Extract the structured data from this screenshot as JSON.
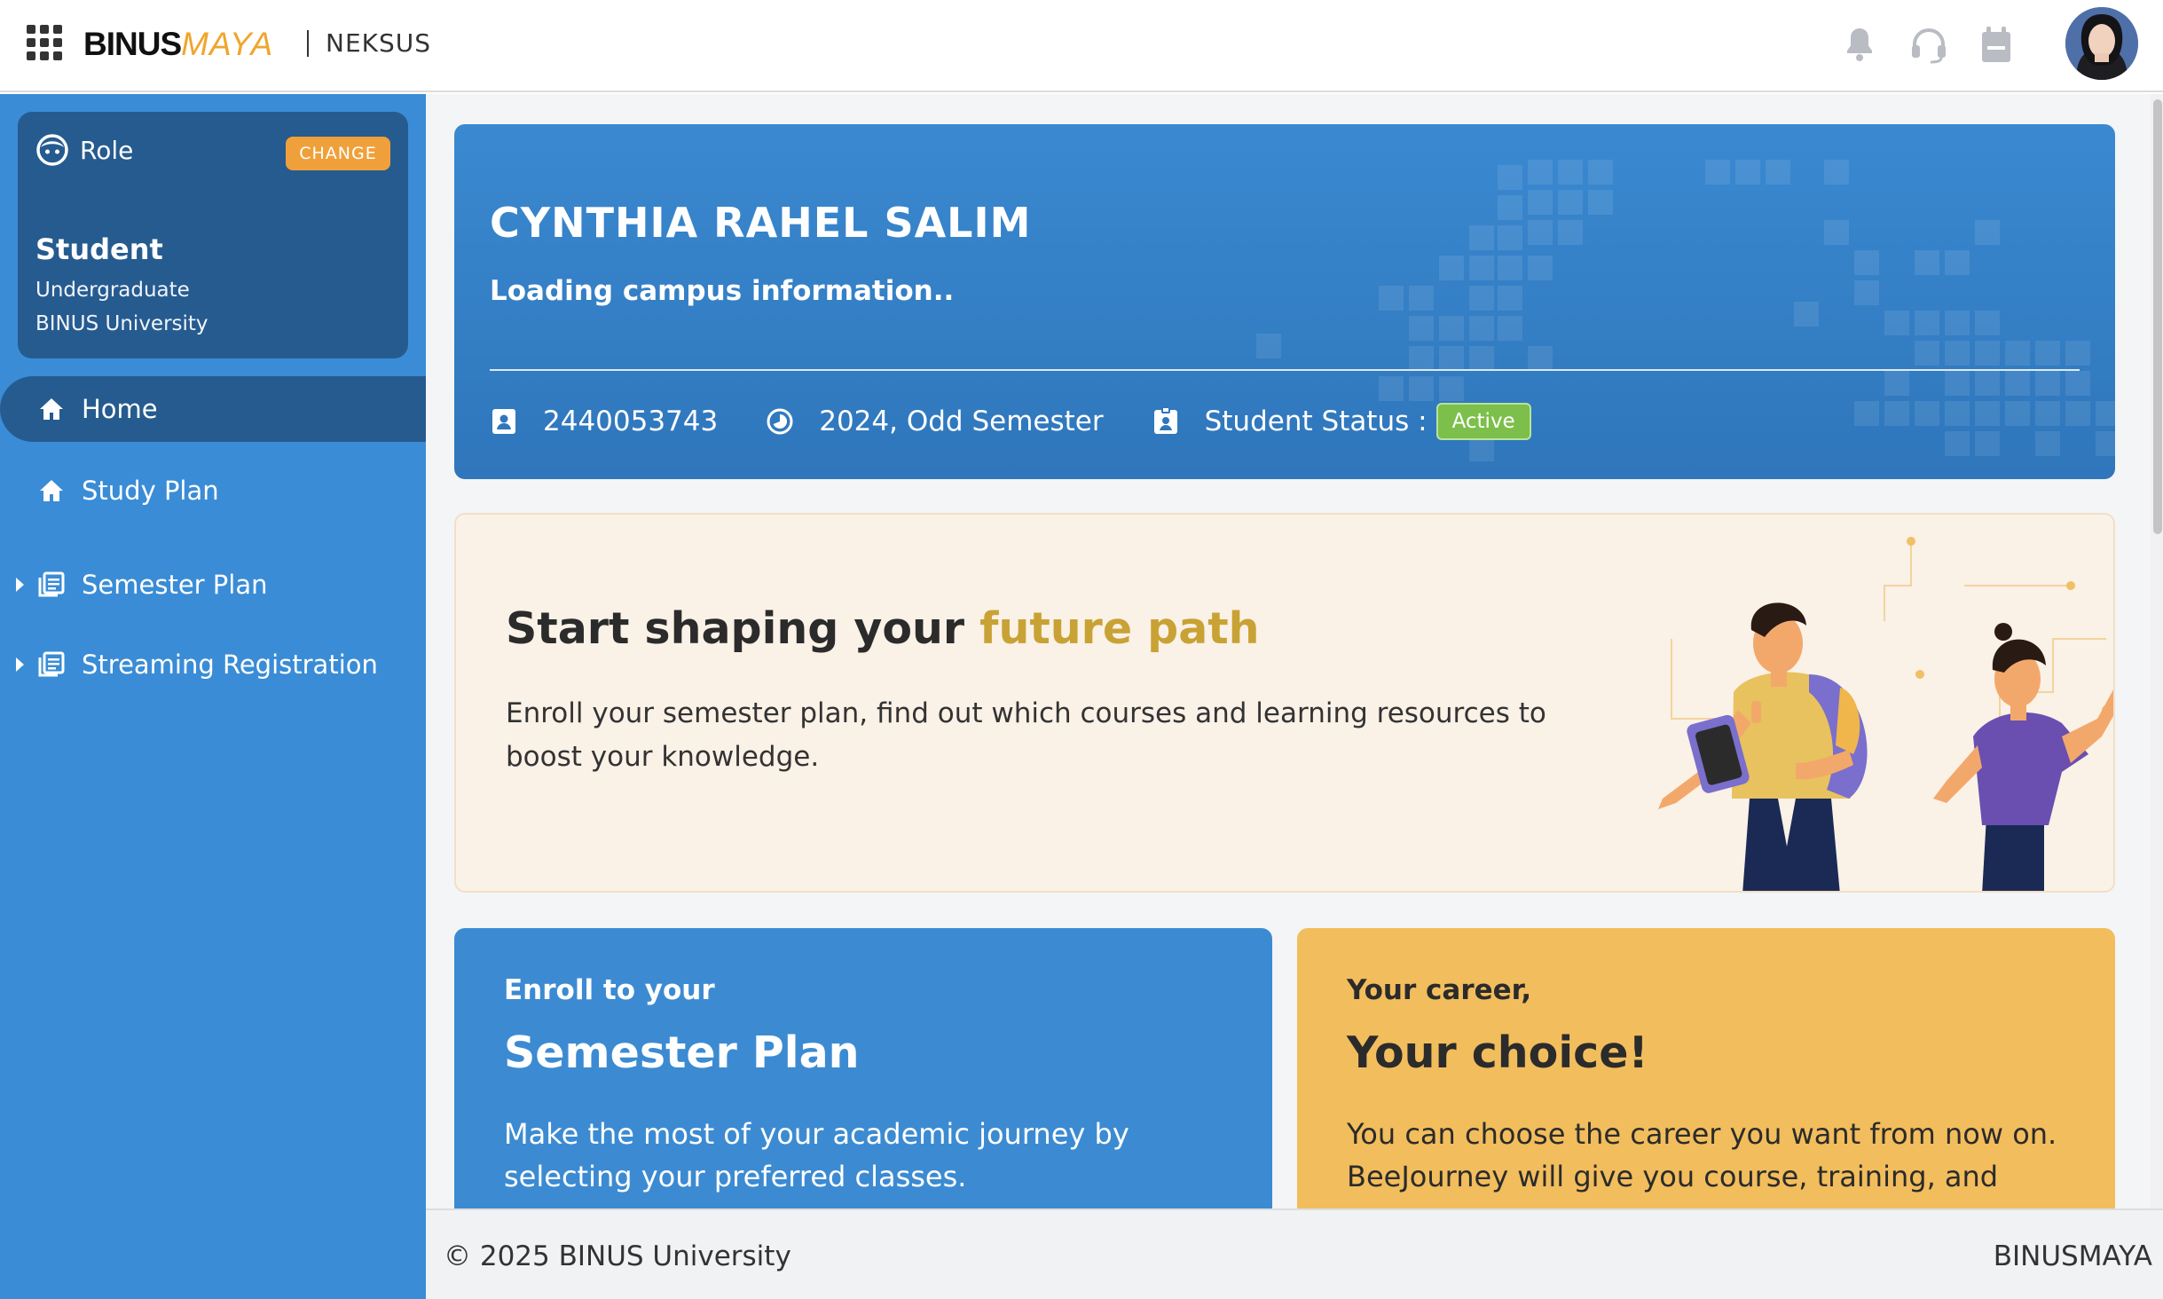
{
  "header": {
    "logo_main": "BINUS",
    "logo_accent": "MAYA",
    "app_name": "NEKSUS",
    "icons": [
      "apps-grid-icon",
      "bell-icon",
      "headset-icon",
      "calendar-icon"
    ],
    "brand_accent": "#f0a52b"
  },
  "sidebar": {
    "role_card": {
      "label": "Role",
      "change_label": "CHANGE",
      "title": "Student",
      "sub1": "Undergraduate",
      "sub2": "BINUS University"
    },
    "items": [
      {
        "label": "Home",
        "icon": "home-icon",
        "active": true
      },
      {
        "label": "Study Plan",
        "icon": "home-icon",
        "active": false
      },
      {
        "label": "Semester Plan",
        "icon": "list-icon",
        "active": false,
        "expandable": true
      },
      {
        "label": "Streaming Registration",
        "icon": "list-icon",
        "active": false,
        "expandable": true
      }
    ],
    "bg_color": "#3a8cd6",
    "active_color": "#265b8f"
  },
  "profile": {
    "name": "CYNTHIA RAHEL SALIM",
    "campus": "Loading campus information..",
    "student_id": "2440053743",
    "period": "2024, Odd Semester",
    "status_label": "Student Status :",
    "status_value": "Active",
    "status_color": "#7cbf4a"
  },
  "future": {
    "title_main": "Start shaping your ",
    "title_accent": "future path",
    "description": "Enroll your semester plan, find out which courses and learning resources to boost your knowledge."
  },
  "cards": {
    "semester": {
      "kicker": "Enroll to your",
      "title": "Semester Plan",
      "description": "Make the most of your academic journey by selecting your preferred classes."
    },
    "career": {
      "kicker": "Your career,",
      "title": "Your choice!",
      "description": "You can choose the career you want from now on. BeeJourney will give you course, training, and"
    }
  },
  "footer": {
    "copyright": "© 2025 BINUS University",
    "brand": "BINUSMAYA"
  }
}
